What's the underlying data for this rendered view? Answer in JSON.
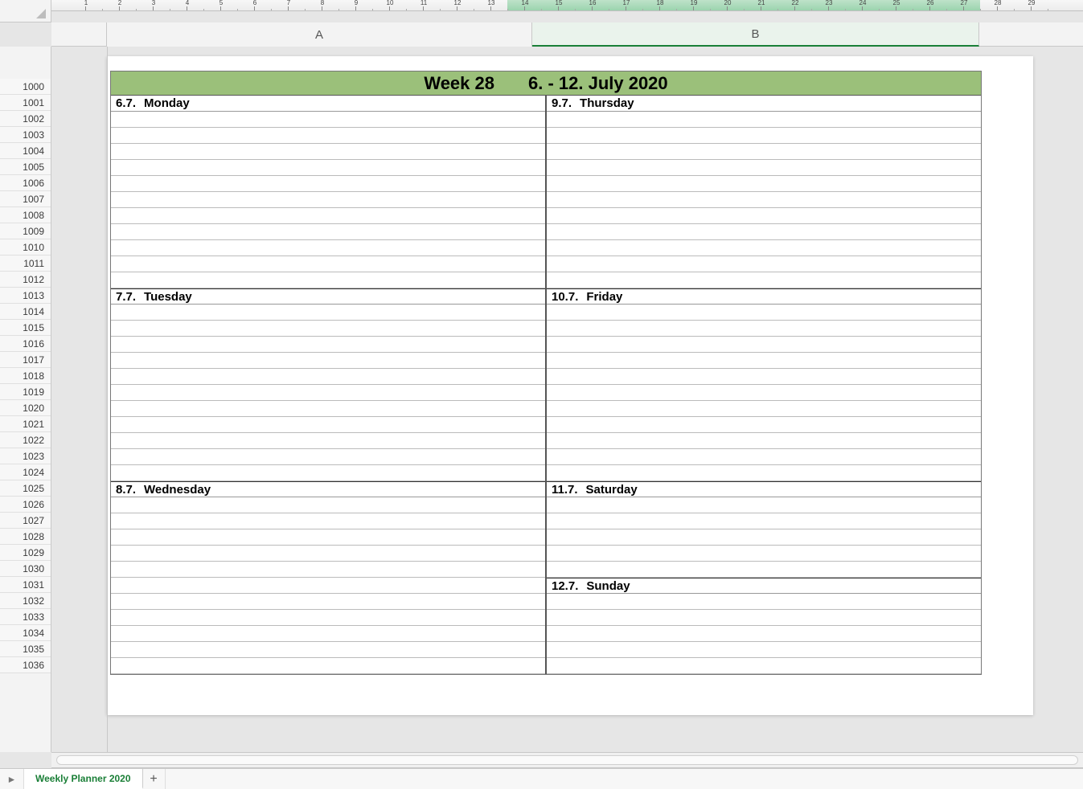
{
  "ruler": {
    "numbers": [
      1,
      2,
      3,
      4,
      5,
      6,
      7,
      8,
      9,
      10,
      11,
      12,
      13,
      14,
      15,
      16,
      17,
      18,
      19,
      20,
      21,
      22,
      23,
      24,
      25,
      26,
      27,
      28,
      29
    ],
    "selection_start": 14,
    "selection_end": 28
  },
  "columns": {
    "A": "A",
    "B": "B",
    "selected": "B"
  },
  "row_start": 1000,
  "row_count": 37,
  "planner": {
    "week_label": "Week 28",
    "date_range": "6. - 12. July 2020",
    "left": [
      {
        "date": "6.7.",
        "day": "Monday",
        "slots": 11
      },
      {
        "date": "7.7.",
        "day": "Tuesday",
        "slots": 11
      },
      {
        "date": "8.7.",
        "day": "Wednesday",
        "slots": 11
      }
    ],
    "right": [
      {
        "date": "9.7.",
        "day": "Thursday",
        "slots": 11
      },
      {
        "date": "10.7.",
        "day": "Friday",
        "slots": 11
      },
      {
        "date": "11.7.",
        "day": "Saturday",
        "slots": 5
      },
      {
        "date": "12.7.",
        "day": "Sunday",
        "slots": 5
      }
    ]
  },
  "tabs": {
    "active": "Weekly Planner 2020",
    "add_glyph": "+",
    "nav_glyph": "►"
  }
}
